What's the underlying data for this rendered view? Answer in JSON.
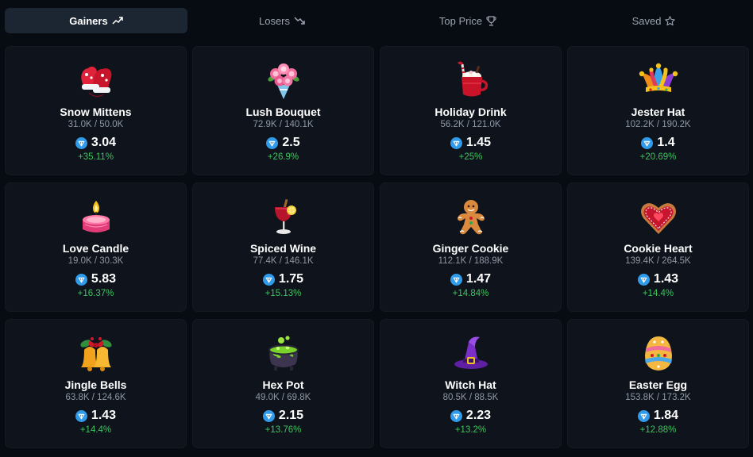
{
  "tabs": [
    {
      "label": "Gainers",
      "icon": "trend-up-icon",
      "active": true
    },
    {
      "label": "Losers",
      "icon": "trend-down-icon",
      "active": false
    },
    {
      "label": "Top Price",
      "icon": "trophy-icon",
      "active": false
    },
    {
      "label": "Saved",
      "icon": "star-icon",
      "active": false
    }
  ],
  "colors": {
    "positive": "#3ec45e",
    "diamond": "#2f9bea",
    "active_tab": "#1c2532",
    "card": "#0e131c"
  },
  "items": [
    {
      "name": "Snow Mittens",
      "supply": "31.0K / 50.0K",
      "price": "3.04",
      "change": "+35.11%",
      "icon": "snow-mittens-icon"
    },
    {
      "name": "Lush Bouquet",
      "supply": "72.9K / 140.1K",
      "price": "2.5",
      "change": "+26.9%",
      "icon": "lush-bouquet-icon"
    },
    {
      "name": "Holiday Drink",
      "supply": "56.2K / 121.0K",
      "price": "1.45",
      "change": "+25%",
      "icon": "holiday-drink-icon"
    },
    {
      "name": "Jester Hat",
      "supply": "102.2K / 190.2K",
      "price": "1.4",
      "change": "+20.69%",
      "icon": "jester-hat-icon"
    },
    {
      "name": "Love Candle",
      "supply": "19.0K / 30.3K",
      "price": "5.83",
      "change": "+16.37%",
      "icon": "love-candle-icon"
    },
    {
      "name": "Spiced Wine",
      "supply": "77.4K / 146.1K",
      "price": "1.75",
      "change": "+15.13%",
      "icon": "spiced-wine-icon"
    },
    {
      "name": "Ginger Cookie",
      "supply": "112.1K / 188.9K",
      "price": "1.47",
      "change": "+14.84%",
      "icon": "ginger-cookie-icon"
    },
    {
      "name": "Cookie Heart",
      "supply": "139.4K / 264.5K",
      "price": "1.43",
      "change": "+14.4%",
      "icon": "cookie-heart-icon"
    },
    {
      "name": "Jingle Bells",
      "supply": "63.8K / 124.6K",
      "price": "1.43",
      "change": "+14.4%",
      "icon": "jingle-bells-icon"
    },
    {
      "name": "Hex Pot",
      "supply": "49.0K / 69.8K",
      "price": "2.15",
      "change": "+13.76%",
      "icon": "hex-pot-icon"
    },
    {
      "name": "Witch Hat",
      "supply": "80.5K / 88.5K",
      "price": "2.23",
      "change": "+13.2%",
      "icon": "witch-hat-icon"
    },
    {
      "name": "Easter Egg",
      "supply": "153.8K / 173.2K",
      "price": "1.84",
      "change": "+12.88%",
      "icon": "easter-egg-icon"
    }
  ]
}
